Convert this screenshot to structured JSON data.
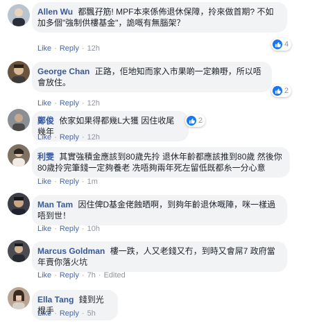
{
  "comments": [
    {
      "name": "Allen Wu",
      "text": "都飄孖筋! MPF本來係佈退休保障，拎來做首期? 不如加多個\"強制供樓基金\"，詭嘅有無腦架？",
      "actions": {
        "like": "Like",
        "reply": "Reply",
        "time": "12h"
      },
      "reactions": "4",
      "avatar_color": "#b9c4cf"
    },
    {
      "name": "George Chan",
      "text": "正路，佢地知而家入市果啲一定賴嘢，所以唔會放住。",
      "actions": {
        "like": "Like",
        "reply": "Reply",
        "time": "12h"
      },
      "reactions": "2",
      "avatar_color": "#6b5440"
    },
    {
      "name": "鄭俊",
      "text": "依家如果得都幾L大獲 因住收尾幾年",
      "actions": {
        "like": "Like",
        "reply": "Reply",
        "time": "12h"
      },
      "reactions": "2",
      "avatar_color": "#8a8f96"
    },
    {
      "name": "利雯",
      "text": "其實強積金應該到80歲先拎 退休年齡都應該推到80歲 然後你80歲拎完筆錢一定夠養老 冼唔夠兩年死左留低既都糸一分心意",
      "actions": {
        "like": "Like",
        "reply": "Reply",
        "time": "1m"
      },
      "reactions": "",
      "avatar_color": "#7e7363"
    },
    {
      "name": "Man Tam",
      "text": "因住俾D基金佬蝕晒啊，到夠年齡退休嘅陣，咪一樣過唔到世！",
      "actions": {
        "like": "Like",
        "reply": "Reply",
        "time": "10h"
      },
      "reactions": "",
      "avatar_color": "#3c3f47"
    },
    {
      "name": "Marcus Goldman",
      "text": "樓一跌，人又老錢又冇，到時又會屌7 政府當年賣你落火坑",
      "actions": {
        "like": "Like",
        "reply": "Reply",
        "time": "7h",
        "edited": "Edited"
      },
      "reactions": "",
      "avatar_color": "#4b4c52"
    },
    {
      "name": "Ella Tang",
      "text": "錢到光棍手",
      "actions": {
        "like": "Like",
        "reply": "Reply",
        "time": "5h"
      },
      "reactions": "",
      "avatar_color": "#b9a493"
    }
  ],
  "colors": {
    "name": "#385898",
    "link": "#4267b2",
    "bubble": "#f2f3f5",
    "meta": "#90949c",
    "like_blue": "#1877f2"
  }
}
